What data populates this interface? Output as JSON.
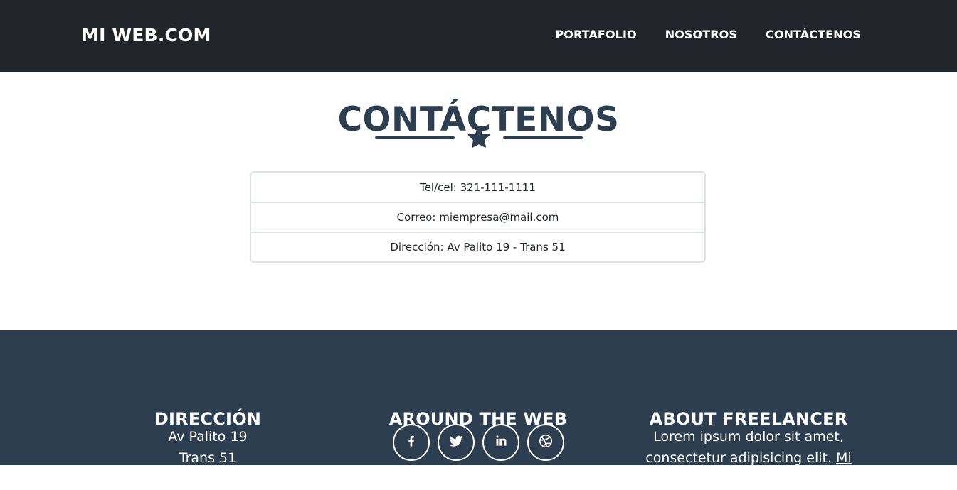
{
  "navbar": {
    "brand": "MI WEB.COM",
    "links": [
      "PORTAFOLIO",
      "NOSOTROS",
      "CONTÁCTENOS"
    ]
  },
  "contact": {
    "title": "CONTÁCTENOS",
    "divider_icon": "star-icon",
    "items": [
      "Tel/cel: 321-111-1111",
      "Correo: miempresa@mail.com",
      "Dirección: Av Palito 19 - Trans 51"
    ]
  },
  "footer": {
    "address": {
      "heading": "DIRECCIÓN",
      "line1": "Av Palito 19",
      "line2": "Trans 51"
    },
    "social": {
      "heading": "AROUND THE WEB",
      "icons": [
        "facebook-icon",
        "twitter-icon",
        "linkedin-icon",
        "dribbble-icon"
      ]
    },
    "about": {
      "heading": "ABOUT FREELANCER",
      "text": "Lorem ipsum dolor sit amet, consectetur adipisicing elit.",
      "link": "Mi Web.Com"
    }
  },
  "colors": {
    "navbar_bg": "#212529",
    "primary": "#2c3e50",
    "border": "#dee2e6",
    "text": "#212529"
  }
}
